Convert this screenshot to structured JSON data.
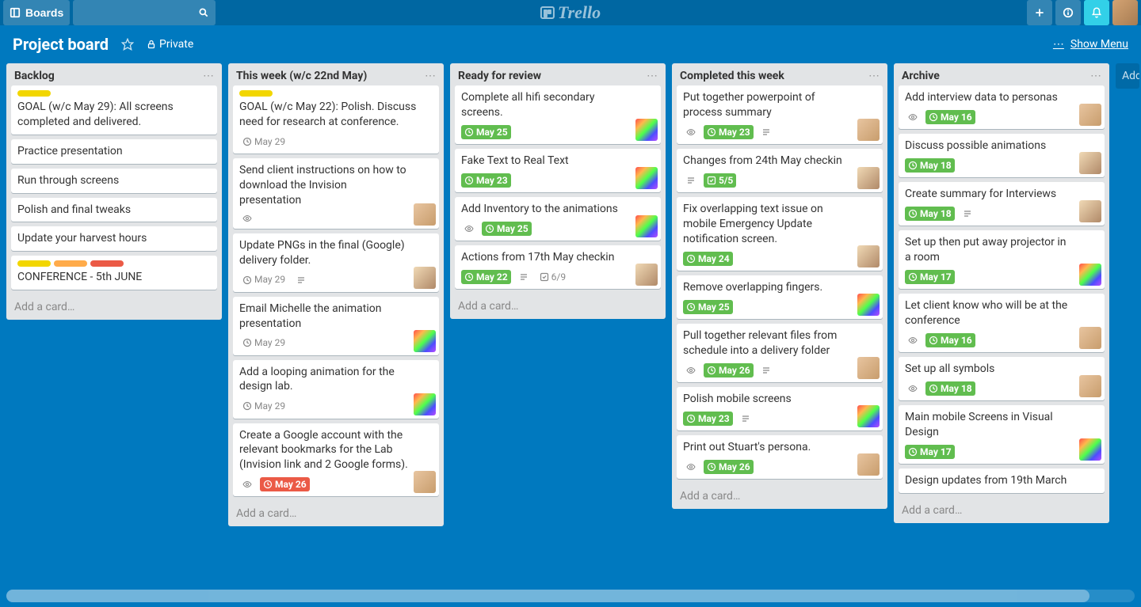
{
  "header": {
    "boards_label": "Boards",
    "logo_text": "Trello"
  },
  "board": {
    "title": "Project board",
    "privacy": "Private",
    "show_menu": "Show Menu"
  },
  "add_list": "Add",
  "add_card_label": "Add a card…",
  "lists": [
    {
      "title": "Backlog",
      "cards": [
        {
          "labels": [
            "yellow"
          ],
          "text": "GOAL (w/c May 29): All screens completed and delivered."
        },
        {
          "text": "Practice presentation"
        },
        {
          "text": "Run through screens"
        },
        {
          "text": "Polish and final tweaks"
        },
        {
          "text": "Update your harvest hours"
        },
        {
          "labels": [
            "yellow",
            "orange",
            "red"
          ],
          "text": "CONFERENCE - 5th JUNE"
        }
      ]
    },
    {
      "title": "This week (w/c 22nd May)",
      "cards": [
        {
          "labels": [
            "yellow"
          ],
          "text": "GOAL (w/c May 22): Polish. Discuss need for research at conference.",
          "due": "May 29",
          "due_state": "none"
        },
        {
          "text": "Send client instructions on how to download the Invision presentation",
          "watch": true,
          "avatar": "av-m1"
        },
        {
          "text": "Update PNGs in the final (Google) delivery folder.",
          "due": "May 29",
          "due_state": "none",
          "desc": true,
          "avatar": "av-m2"
        },
        {
          "text": "Email Michelle the animation presentation",
          "due": "May 29",
          "due_state": "none",
          "avatar": "av-rainbow"
        },
        {
          "text": "Add a looping animation for the design lab.",
          "due": "May 29",
          "due_state": "none",
          "avatar": "av-rainbow"
        },
        {
          "text": "Create a Google account with the relevant bookmarks for the Lab (Invision link and 2 Google forms).",
          "watch": true,
          "due": "May 26",
          "due_state": "red",
          "avatar": "av-m1"
        }
      ]
    },
    {
      "title": "Ready for review",
      "cards": [
        {
          "text": "Complete all hifi secondary screens.",
          "due": "May 25",
          "due_state": "green",
          "avatar": "av-rainbow"
        },
        {
          "text": "Fake Text to Real Text",
          "due": "May 23",
          "due_state": "green",
          "avatar": "av-rainbow"
        },
        {
          "text": "Add Inventory to the animations",
          "watch": true,
          "due": "May 25",
          "due_state": "green",
          "avatar": "av-rainbow"
        },
        {
          "text": "Actions from 17th May checkin",
          "due": "May 22",
          "due_state": "green",
          "desc": true,
          "checklist": "6/9",
          "avatar": "av-m2"
        }
      ]
    },
    {
      "title": "Completed this week",
      "cards": [
        {
          "text": "Put together powerpoint of process summary",
          "watch": true,
          "due": "May 23",
          "due_state": "green",
          "desc": true,
          "avatar": "av-m1"
        },
        {
          "text": "Changes from 24th May checkin",
          "desc": true,
          "checklist": "5/5",
          "check_done": true,
          "avatar": "av-m2"
        },
        {
          "text": "Fix overlapping text issue on mobile Emergency Update notification screen.",
          "due": "May 24",
          "due_state": "green",
          "avatar": "av-m2"
        },
        {
          "text": "Remove overlapping fingers.",
          "due": "May 25",
          "due_state": "green",
          "avatar": "av-rainbow"
        },
        {
          "text": "Pull together relevant files from schedule into a delivery folder",
          "watch": true,
          "due": "May 26",
          "due_state": "green",
          "desc": true,
          "avatar": "av-m1"
        },
        {
          "text": "Polish mobile screens",
          "due": "May 23",
          "due_state": "green",
          "desc": true,
          "avatar": "av-rainbow"
        },
        {
          "text": "Print out Stuart's persona.",
          "watch": true,
          "due": "May 26",
          "due_state": "green",
          "avatar": "av-m1"
        }
      ]
    },
    {
      "title": "Archive",
      "cards": [
        {
          "text": "Add interview data to personas",
          "watch": true,
          "due": "May 16",
          "due_state": "green",
          "avatar": "av-m1"
        },
        {
          "text": "Discuss possible animations",
          "due": "May 18",
          "due_state": "green",
          "avatar": "av-m2"
        },
        {
          "text": "Create summary for Interviews",
          "due": "May 18",
          "due_state": "green",
          "desc": true,
          "avatar": "av-m2"
        },
        {
          "text": "Set up then put away projector in a room",
          "due": "May 17",
          "due_state": "green",
          "avatar": "av-rainbow"
        },
        {
          "text": "Let client know who will be at the conference",
          "watch": true,
          "due": "May 16",
          "due_state": "green",
          "avatar": "av-m1"
        },
        {
          "text": "Set up all symbols",
          "watch": true,
          "due": "May 18",
          "due_state": "green",
          "avatar": "av-m1"
        },
        {
          "text": "Main mobile Screens in Visual Design",
          "due": "May 17",
          "due_state": "green",
          "avatar": "av-rainbow"
        },
        {
          "text": "Design updates from 19th March"
        }
      ]
    }
  ]
}
